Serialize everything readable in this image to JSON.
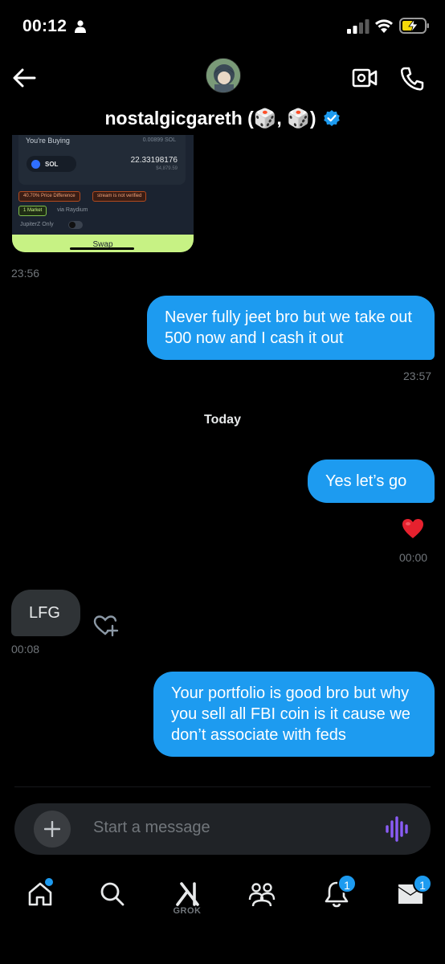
{
  "status_bar": {
    "time": "00:12"
  },
  "header": {
    "name": "nostalgicgareth (🎲, 🎲)",
    "verified": true
  },
  "shared_image": {
    "buying_label": "You're Buying",
    "balance": "0.00899 SOL",
    "token": "SOL",
    "amount": "22.33198176",
    "usd_value": "$4,879.59",
    "warning_price": "40.70% Price Difference",
    "warning_stream": "stream is not verified",
    "market": "1 Market",
    "via": "via Raydium",
    "jupiterz": "JupiterZ Only",
    "swap": "Swap"
  },
  "messages": [
    {
      "id": "img-ts",
      "time": "23:56"
    },
    {
      "id": "m1",
      "direction": "out",
      "text": "Never fully jeet bro but we take out 500 now and I cash it out",
      "time": "23:57"
    },
    {
      "id": "m2",
      "direction": "out",
      "text": "Yes let’s go",
      "time": "00:00",
      "reaction": "❤️"
    },
    {
      "id": "m3",
      "direction": "in",
      "text": "LFG",
      "time": "00:08"
    },
    {
      "id": "m4",
      "direction": "out",
      "text": "Your portfolio is good bro but why you sell all FBI coin is it cause we don’t associate with feds"
    }
  ],
  "day_separator": "Today",
  "composer": {
    "placeholder": "Start a message"
  },
  "tabs": {
    "grok_label": "GROK",
    "notifications_badge": "1",
    "messages_badge": "1"
  },
  "colors": {
    "accent": "#1d9bf0",
    "incoming_bubble": "#2f3336",
    "voice_icon": "#8a5cf6"
  }
}
